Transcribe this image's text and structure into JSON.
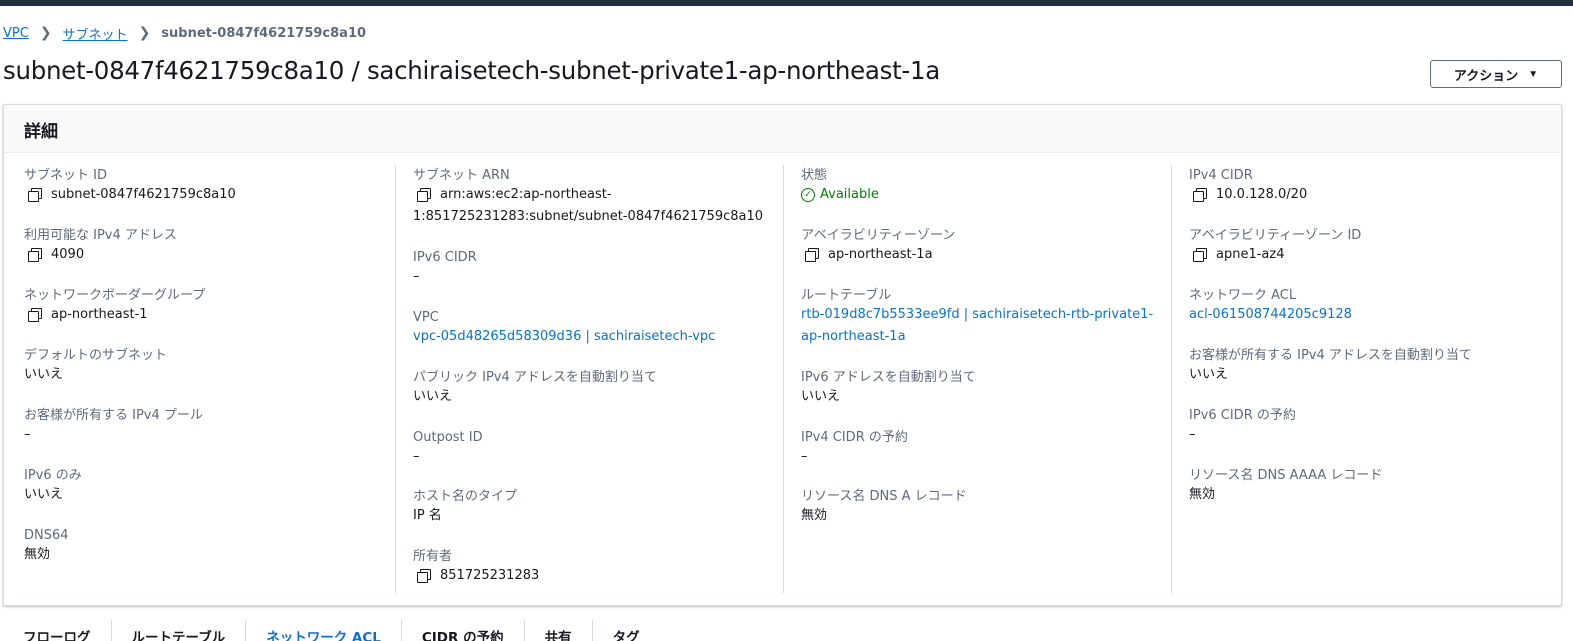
{
  "breadcrumb": {
    "items": [
      "VPC",
      "サブネット"
    ],
    "current": "subnet-0847f4621759c8a10"
  },
  "page": {
    "title": "subnet-0847f4621759c8a10 / sachiraisetech-subnet-private1-ap-northeast-1a",
    "action_label": "アクション"
  },
  "details": {
    "title": "詳細",
    "col1": {
      "subnet_id": {
        "label": "サブネット ID",
        "value": "subnet-0847f4621759c8a10"
      },
      "available_ipv4": {
        "label": "利用可能な IPv4 アドレス",
        "value": "4090"
      },
      "border_group": {
        "label": "ネットワークボーダーグループ",
        "value": "ap-northeast-1"
      },
      "default_subnet": {
        "label": "デフォルトのサブネット",
        "value": "いいえ"
      },
      "customer_ipv4_pool": {
        "label": "お客様が所有する IPv4 プール",
        "value": "–"
      },
      "ipv6_only": {
        "label": "IPv6 のみ",
        "value": "いいえ"
      },
      "dns64": {
        "label": "DNS64",
        "value": "無効"
      }
    },
    "col2": {
      "subnet_arn": {
        "label": "サブネット ARN",
        "value_line1": "arn:aws:ec2:ap-northeast-",
        "value_line2": "1:851725231283:subnet/subnet-0847f4621759c8a10"
      },
      "ipv6_cidr": {
        "label": "IPv6 CIDR",
        "value": "–"
      },
      "vpc": {
        "label": "VPC",
        "value": "vpc-05d48265d58309d36 | sachiraisetech-vpc"
      },
      "auto_assign_public_ipv4": {
        "label": "パブリック IPv4 アドレスを自動割り当て",
        "value": "いいえ"
      },
      "outpost_id": {
        "label": "Outpost ID",
        "value": "–"
      },
      "hostname_type": {
        "label": "ホスト名のタイプ",
        "value": "IP 名"
      },
      "owner": {
        "label": "所有者",
        "value": "851725231283"
      }
    },
    "col3": {
      "state": {
        "label": "状態",
        "value": "Available"
      },
      "az": {
        "label": "アベイラビリティーゾーン",
        "value": "ap-northeast-1a"
      },
      "route_table": {
        "label": "ルートテーブル",
        "value_line1": "rtb-019d8c7b5533ee9fd | sachiraisetech-rtb-private1-",
        "value_line2": "ap-northeast-1a"
      },
      "auto_assign_ipv6": {
        "label": "IPv6 アドレスを自動割り当て",
        "value": "いいえ"
      },
      "ipv4_cidr_reservation": {
        "label": "IPv4 CIDR の予約",
        "value": "–"
      },
      "dns_a_record": {
        "label": "リソース名 DNS A レコード",
        "value": "無効"
      }
    },
    "col4": {
      "ipv4_cidr": {
        "label": "IPv4 CIDR",
        "value": "10.0.128.0/20"
      },
      "az_id": {
        "label": "アベイラビリティーゾーン ID",
        "value": "apne1-az4"
      },
      "network_acl": {
        "label": "ネットワーク ACL",
        "value": "acl-061508744205c9128"
      },
      "customer_auto_ipv4": {
        "label": "お客様が所有する IPv4 アドレスを自動割り当て",
        "value": "いいえ"
      },
      "ipv6_cidr_reservation": {
        "label": "IPv6 CIDR の予約",
        "value": "–"
      },
      "dns_aaaa_record": {
        "label": "リソース名 DNS AAAA レコード",
        "value": "無効"
      }
    }
  },
  "tabs": [
    "フローログ",
    "ルートテーブル",
    "ネットワーク ACL",
    "CIDR の予約",
    "共有",
    "タグ"
  ],
  "colors": {
    "link": "#0972d3",
    "success": "#037f0c",
    "topbar": "#232f3e"
  }
}
